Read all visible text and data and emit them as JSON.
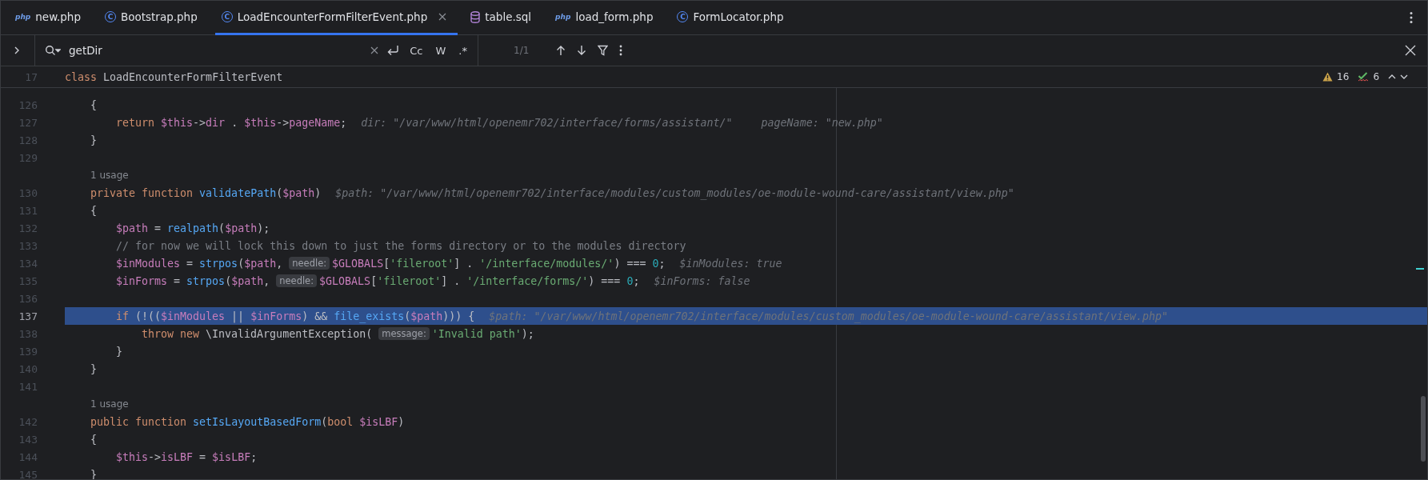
{
  "tabs": [
    {
      "kind": "php",
      "icon_text": "php",
      "label": "new.php",
      "selected": false,
      "closable": false
    },
    {
      "kind": "class",
      "icon_text": "C",
      "label": "Bootstrap.php",
      "selected": false,
      "closable": false
    },
    {
      "kind": "class",
      "icon_text": "C",
      "label": "LoadEncounterFormFilterEvent.php",
      "selected": true,
      "closable": true
    },
    {
      "kind": "sql",
      "label": "table.sql",
      "selected": false,
      "closable": false
    },
    {
      "kind": "php",
      "icon_text": "php",
      "label": "load_form.php",
      "selected": false,
      "closable": false
    },
    {
      "kind": "class",
      "icon_text": "C",
      "label": "FormLocator.php",
      "selected": false,
      "closable": false
    }
  ],
  "find": {
    "value": "getDir",
    "options": [
      {
        "label": "Cc",
        "selected": false
      },
      {
        "label": "W",
        "selected": false
      },
      {
        "label": ".*",
        "selected": false
      }
    ],
    "match_count": "1/1"
  },
  "sticky_header": {
    "number": "17",
    "tokens": [
      {
        "kind": "keyword",
        "text": "class"
      },
      {
        "kind": "plain",
        "text": " LoadEncounterFormFilterEvent"
      }
    ]
  },
  "inspections": {
    "warnings": "16",
    "typos": "6"
  },
  "lines": [
    {
      "kind": "code",
      "number": "126",
      "highlighted": false,
      "tokens": [
        {
          "kind": "plain",
          "text": "{"
        }
      ],
      "children": [
        {
          "kind": "code",
          "number": "127",
          "highlighted": false,
          "tokens": [
            {
              "kind": "keyword",
              "text": "return "
            },
            {
              "kind": "variable",
              "text": "$this"
            },
            {
              "kind": "plain",
              "text": "->"
            },
            {
              "kind": "variable",
              "text": "dir"
            },
            {
              "kind": "plain",
              "text": " . "
            },
            {
              "kind": "variable",
              "text": "$this"
            },
            {
              "kind": "plain",
              "text": "->"
            },
            {
              "kind": "variable",
              "text": "pageName"
            },
            {
              "kind": "plain",
              "text": ";"
            },
            {
              "kind": "inlay",
              "text": "dir: \"/var/www/html/openemr702/interface/forms/assistant/\""
            },
            {
              "kind": "inlay",
              "text": "pageName: \"new.php\""
            }
          ]
        }
      ]
    },
    {
      "kind": "code",
      "number": "128",
      "highlighted": false,
      "tokens": [
        {
          "kind": "plain",
          "text": "}"
        }
      ]
    },
    {
      "kind": "code",
      "number": "129",
      "highlighted": false
    },
    {
      "kind": "usage",
      "text": "1 usage"
    },
    {
      "kind": "code",
      "number": "130",
      "highlighted": false,
      "tokens": [
        {
          "kind": "keyword",
          "text": "private function "
        },
        {
          "kind": "function",
          "text": "validatePath"
        },
        {
          "kind": "plain",
          "text": "("
        },
        {
          "kind": "variable",
          "text": "$path"
        },
        {
          "kind": "plain",
          "text": ")"
        },
        {
          "kind": "inlay",
          "text": "$path: \"/var/www/html/openemr702/interface/modules/custom_modules/oe-module-wound-care/assistant/view.php\""
        }
      ]
    },
    {
      "kind": "code",
      "number": "131",
      "highlighted": false,
      "tokens": [
        {
          "kind": "plain",
          "text": "{"
        }
      ],
      "children": [
        {
          "kind": "code",
          "number": "132",
          "highlighted": false,
          "tokens": [
            {
              "kind": "variable",
              "text": "$path"
            },
            {
              "kind": "plain",
              "text": " = "
            },
            {
              "kind": "function",
              "text": "realpath"
            },
            {
              "kind": "plain",
              "text": "("
            },
            {
              "kind": "variable",
              "text": "$path"
            },
            {
              "kind": "plain",
              "text": ");"
            }
          ]
        },
        {
          "kind": "code",
          "number": "133",
          "highlighted": false,
          "tokens": [
            {
              "kind": "comment",
              "text": "// for now we will lock this down to just the forms directory or to the modules directory"
            }
          ]
        },
        {
          "kind": "code",
          "number": "134",
          "highlighted": false,
          "tokens": [
            {
              "kind": "variable",
              "text": "$inModules"
            },
            {
              "kind": "plain",
              "text": " = "
            },
            {
              "kind": "function",
              "text": "strpos"
            },
            {
              "kind": "plain",
              "text": "("
            },
            {
              "kind": "variable",
              "text": "$path"
            },
            {
              "kind": "plain",
              "text": ","
            },
            {
              "kind": "hint",
              "text": "needle:"
            },
            {
              "kind": "variable",
              "text": "$GLOBALS"
            },
            {
              "kind": "plain",
              "text": "["
            },
            {
              "kind": "string",
              "text": "'fileroot'"
            },
            {
              "kind": "plain",
              "text": "] . "
            },
            {
              "kind": "string",
              "text": "'/interface/modules/'"
            },
            {
              "kind": "plain",
              "text": ") === "
            },
            {
              "kind": "number",
              "text": "0"
            },
            {
              "kind": "plain",
              "text": ";"
            },
            {
              "kind": "inlay",
              "text": "$inModules: true"
            }
          ]
        },
        {
          "kind": "code",
          "number": "135",
          "highlighted": false,
          "tokens": [
            {
              "kind": "variable",
              "text": "$inForms"
            },
            {
              "kind": "plain",
              "text": " = "
            },
            {
              "kind": "function",
              "text": "strpos"
            },
            {
              "kind": "plain",
              "text": "("
            },
            {
              "kind": "variable",
              "text": "$path"
            },
            {
              "kind": "plain",
              "text": ","
            },
            {
              "kind": "hint",
              "text": "needle:"
            },
            {
              "kind": "variable",
              "text": "$GLOBALS"
            },
            {
              "kind": "plain",
              "text": "["
            },
            {
              "kind": "string",
              "text": "'fileroot'"
            },
            {
              "kind": "plain",
              "text": "] . "
            },
            {
              "kind": "string",
              "text": "'/interface/forms/'"
            },
            {
              "kind": "plain",
              "text": ") === "
            },
            {
              "kind": "number",
              "text": "0"
            },
            {
              "kind": "plain",
              "text": ";"
            },
            {
              "kind": "inlay",
              "text": "$inForms: false"
            }
          ]
        },
        {
          "kind": "code",
          "number": "136",
          "highlighted": false
        },
        {
          "kind": "code",
          "number": "137",
          "highlighted": true,
          "tokens": [
            {
              "kind": "keyword",
              "text": "if"
            },
            {
              "kind": "plain",
              "text": " (!(("
            },
            {
              "kind": "variable",
              "text": "$inModules"
            },
            {
              "kind": "plain",
              "text": " || "
            },
            {
              "kind": "variable",
              "text": "$inForms"
            },
            {
              "kind": "plain",
              "text": ") && "
            },
            {
              "kind": "function",
              "text": "file_exists"
            },
            {
              "kind": "plain",
              "text": "("
            },
            {
              "kind": "variable",
              "text": "$path"
            },
            {
              "kind": "plain",
              "text": "))) {"
            },
            {
              "kind": "inlay",
              "text": "$path: \"/var/www/html/openemr702/interface/modules/custom_modules/oe-module-wound-care/assistant/view.php\""
            }
          ],
          "children": [
            {
              "kind": "code",
              "number": "138",
              "highlighted": false,
              "tokens": [
                {
                  "kind": "keyword",
                  "text": "throw new "
                },
                {
                  "kind": "plain",
                  "text": "\\InvalidArgumentException("
                },
                {
                  "kind": "hint",
                  "text": "message:"
                },
                {
                  "kind": "string",
                  "text": "'Invalid path'"
                },
                {
                  "kind": "plain",
                  "text": ");"
                }
              ]
            }
          ]
        },
        {
          "kind": "code",
          "number": "139",
          "highlighted": false,
          "tokens": [
            {
              "kind": "plain",
              "text": "}"
            }
          ]
        }
      ]
    },
    {
      "kind": "code",
      "number": "140",
      "highlighted": false,
      "tokens": [
        {
          "kind": "plain",
          "text": "}"
        }
      ]
    },
    {
      "kind": "code",
      "number": "141",
      "highlighted": false
    },
    {
      "kind": "usage",
      "text": "1 usage"
    },
    {
      "kind": "code",
      "number": "142",
      "highlighted": false,
      "tokens": [
        {
          "kind": "keyword",
          "text": "public function "
        },
        {
          "kind": "function",
          "text": "setIsLayoutBasedForm"
        },
        {
          "kind": "plain",
          "text": "("
        },
        {
          "kind": "keyword",
          "text": "bool "
        },
        {
          "kind": "variable",
          "text": "$isLBF"
        },
        {
          "kind": "plain",
          "text": ")"
        }
      ]
    },
    {
      "kind": "code",
      "number": "143",
      "highlighted": false,
      "tokens": [
        {
          "kind": "plain",
          "text": "{"
        }
      ],
      "children": [
        {
          "kind": "code",
          "number": "144",
          "highlighted": false,
          "tokens": [
            {
              "kind": "variable",
              "text": "$this"
            },
            {
              "kind": "plain",
              "text": "->"
            },
            {
              "kind": "variable",
              "text": "isLBF"
            },
            {
              "kind": "plain",
              "text": " = "
            },
            {
              "kind": "variable",
              "text": "$isLBF"
            },
            {
              "kind": "plain",
              "text": ";"
            }
          ]
        }
      ]
    },
    {
      "kind": "code",
      "number": "145",
      "highlighted": false,
      "tokens": [
        {
          "kind": "plain",
          "text": "}"
        }
      ]
    }
  ]
}
